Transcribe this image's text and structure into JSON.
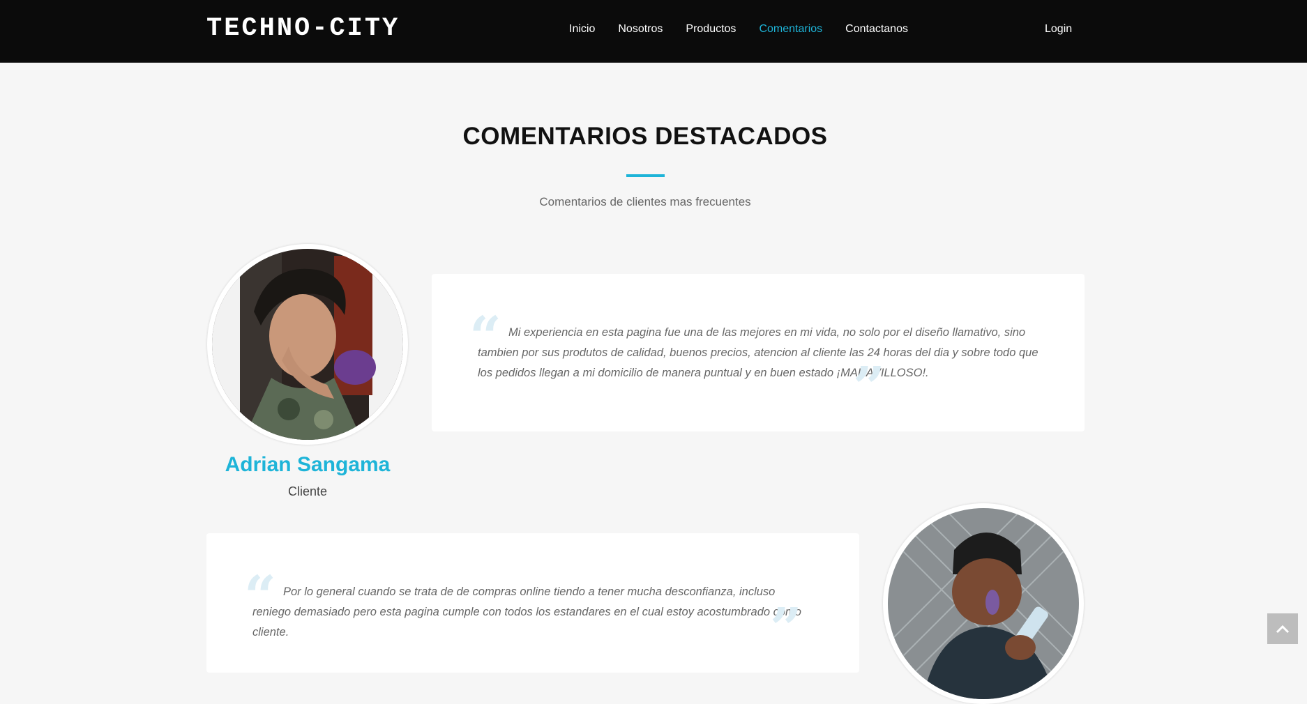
{
  "nav": {
    "brand": "TECHNO-CITY",
    "links": [
      "Inicio",
      "Nosotros",
      "Productos",
      "Comentarios",
      "Contactanos"
    ],
    "active": "Comentarios",
    "login": "Login"
  },
  "section": {
    "title": "COMENTARIOS DESTACADOS",
    "subtitle": "Comentarios de clientes mas frecuentes"
  },
  "testimonials": [
    {
      "name": "Adrian Sangama",
      "role": "Cliente",
      "text": "Mi experiencia en esta pagina fue una de las mejores en mi vida, no solo por el diseño llamativo, sino tambien por sus produtos de calidad, buenos precios, atencion al cliente las 24 horas del dia y sobre todo que los pedidos llegan a mi domicilio de manera puntual y en buen estado ¡MARAVILLOSO!."
    },
    {
      "text": "Por lo general cuando se trata de de compras online tiendo a tener mucha desconfianza, incluso reniego demasiado pero esta pagina cumple con todos los estandares en el cual estoy acostumbrado como cliente."
    }
  ],
  "colors": {
    "accent": "#1eb4d8",
    "navbar": "#0b0b0b",
    "background": "#f6f6f6"
  }
}
